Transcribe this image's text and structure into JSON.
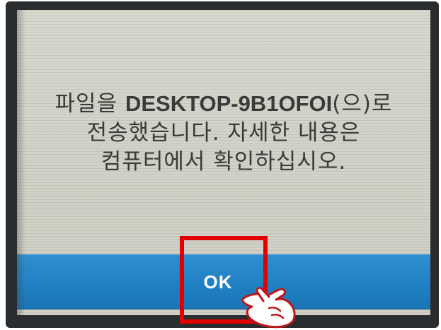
{
  "dialog": {
    "message_line1_pre": "파일을 ",
    "message_line1_code": "DESKTOP-9B1OFOI",
    "message_line1_post": "(으)로",
    "message_line2": "전송했습니다. 자세한 내용은",
    "message_line3": "컴퓨터에서 확인하십시오."
  },
  "actions": {
    "ok_label": "OK"
  },
  "colors": {
    "screen_bg": "#d4d4ca",
    "ok_bar": "#1f7fc2",
    "highlight": "#e00000",
    "bezel": "#2a2d30"
  },
  "icons": {
    "pointer": "pointing-hand-icon"
  }
}
